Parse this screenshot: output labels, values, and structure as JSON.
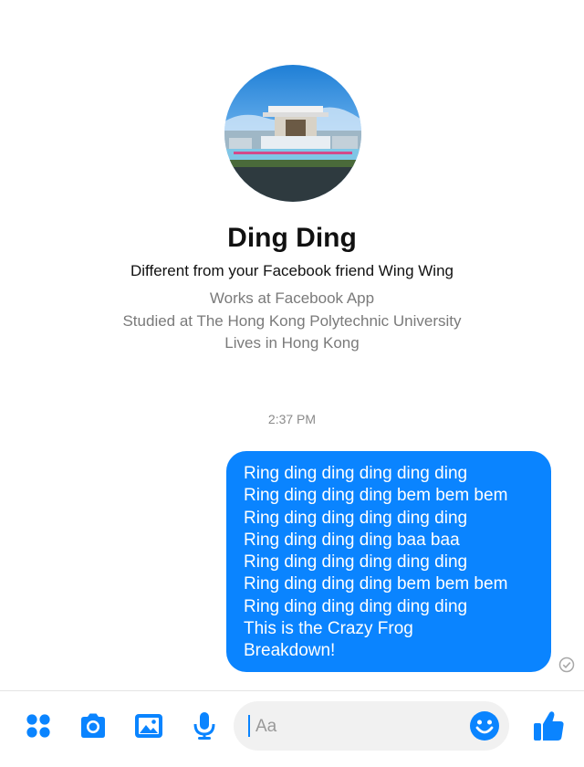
{
  "profile": {
    "name": "Ding Ding",
    "subtitle": "Different from your Facebook friend Wing Wing",
    "work": "Works at Facebook App",
    "education": "Studied at The Hong Kong Polytechnic University",
    "location": "Lives in Hong Kong"
  },
  "conversation": {
    "timestamp": "2:37 PM",
    "message_lines": [
      "Ring ding ding ding ding ding",
      "Ring ding ding ding bem bem bem",
      "Ring ding ding ding ding ding",
      "Ring ding ding ding baa baa",
      "Ring ding ding ding ding ding",
      "Ring ding ding ding bem bem bem",
      "Ring ding ding ding ding ding",
      "This is the Crazy Frog",
      "Breakdown!"
    ]
  },
  "composer": {
    "placeholder": "Aa",
    "icons": [
      "apps-icon",
      "camera-icon",
      "gallery-icon",
      "microphone-icon",
      "emoji-icon",
      "thumbs-up-icon"
    ]
  },
  "colors": {
    "accent": "#0a84ff",
    "bubble_text": "#ffffff",
    "secondary_text": "#7a7a7a"
  }
}
